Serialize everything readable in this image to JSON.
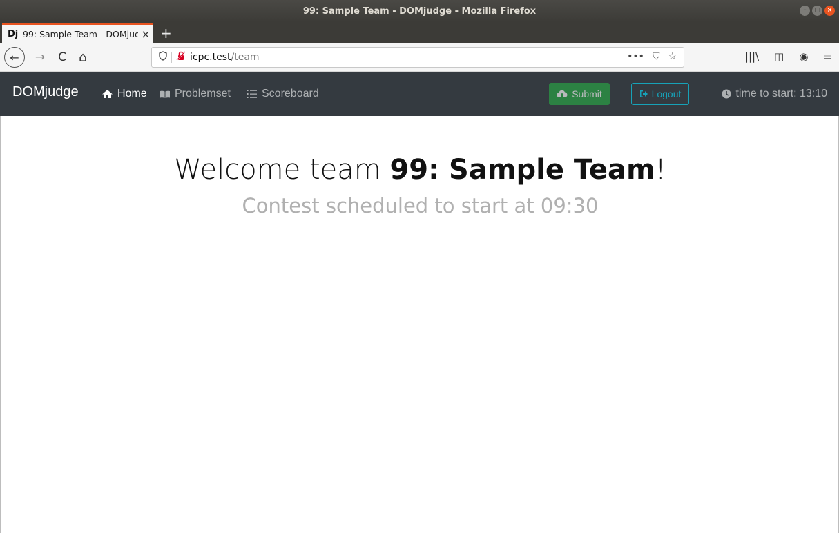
{
  "window": {
    "title": "99: Sample Team - DOMjudge - Mozilla Firefox",
    "controls": [
      "minimize",
      "maximize",
      "close"
    ]
  },
  "tab": {
    "favicon": "Dj",
    "title": "99: Sample Team - DOMjudge",
    "close_glyph": "×"
  },
  "newtab_glyph": "+",
  "navbar": {
    "back_glyph": "←",
    "forward_glyph": "→",
    "reload_glyph": "C",
    "home_glyph": "⌂",
    "url_host": "icpc.test",
    "url_path": "/team",
    "page_actions_glyph": "•••",
    "pocket_glyph": "⛉",
    "bookmark_glyph": "☆",
    "library_glyph": "|||\\",
    "sidebar_glyph": "◫",
    "account_glyph": "◉",
    "menu_glyph": "≡"
  },
  "dj": {
    "brand": "DOMjudge",
    "nav": {
      "home": "Home",
      "problemset": "Problemset",
      "scoreboard": "Scoreboard"
    },
    "submit_label": "Submit",
    "logout_label": "Logout",
    "timer_text": "time to start: 13:10"
  },
  "main": {
    "welcome_prefix": "Welcome team ",
    "team_name": "99: Sample Team",
    "welcome_suffix": "!",
    "scheduled": "Contest scheduled to start at 09:30"
  },
  "colors": {
    "navbar_bg": "#343a40",
    "submit_green": "#28a745",
    "logout_teal": "#17a2b8",
    "tab_accent": "#e95420"
  }
}
